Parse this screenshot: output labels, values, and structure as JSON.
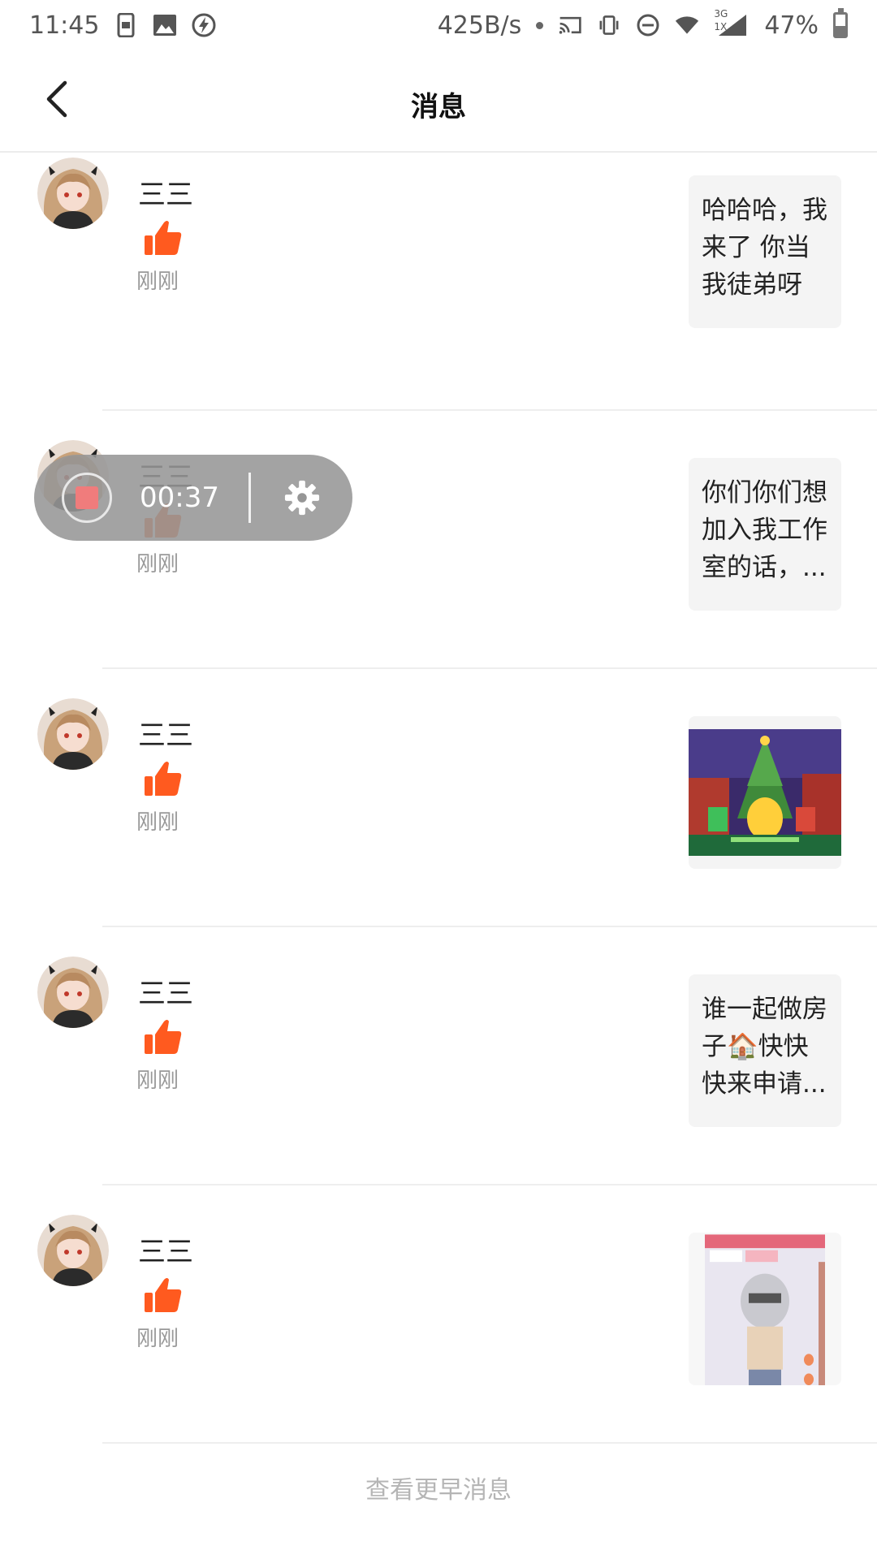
{
  "status_bar": {
    "time": "11:45",
    "net_speed": "425B/s",
    "network_type": "3G",
    "network_sub": "1X",
    "battery": "47%",
    "battery_level": 0.47,
    "icons": [
      "screen-record-icon",
      "image-icon",
      "flash-icon",
      "cast-icon",
      "vibrate-icon",
      "dnd-icon",
      "wifi-icon",
      "signal-icon",
      "battery-icon"
    ]
  },
  "header": {
    "title": "消息",
    "back_icon": "chevron-left-icon"
  },
  "messages": [
    {
      "username": "三三",
      "time": "刚刚",
      "preview_type": "text",
      "preview": " 哈哈哈，我来了 你当我徒弟呀"
    },
    {
      "username": "三三",
      "time": "刚刚",
      "preview_type": "text",
      "preview": "你们你们想加入我工作室的话，..."
    },
    {
      "username": "三三",
      "time": "刚刚",
      "preview_type": "image",
      "preview": ""
    },
    {
      "username": "三三",
      "time": "刚刚",
      "preview_type": "text",
      "preview": "谁一起做房子🏠快快快来申请..."
    },
    {
      "username": "三三",
      "time": "刚刚",
      "preview_type": "image",
      "preview": ""
    }
  ],
  "footer": {
    "view_earlier": "查看更早消息"
  },
  "recorder": {
    "elapsed": "00:37"
  },
  "colors": {
    "like": "#ff5a1f",
    "accent_record": "#f07c7c"
  }
}
